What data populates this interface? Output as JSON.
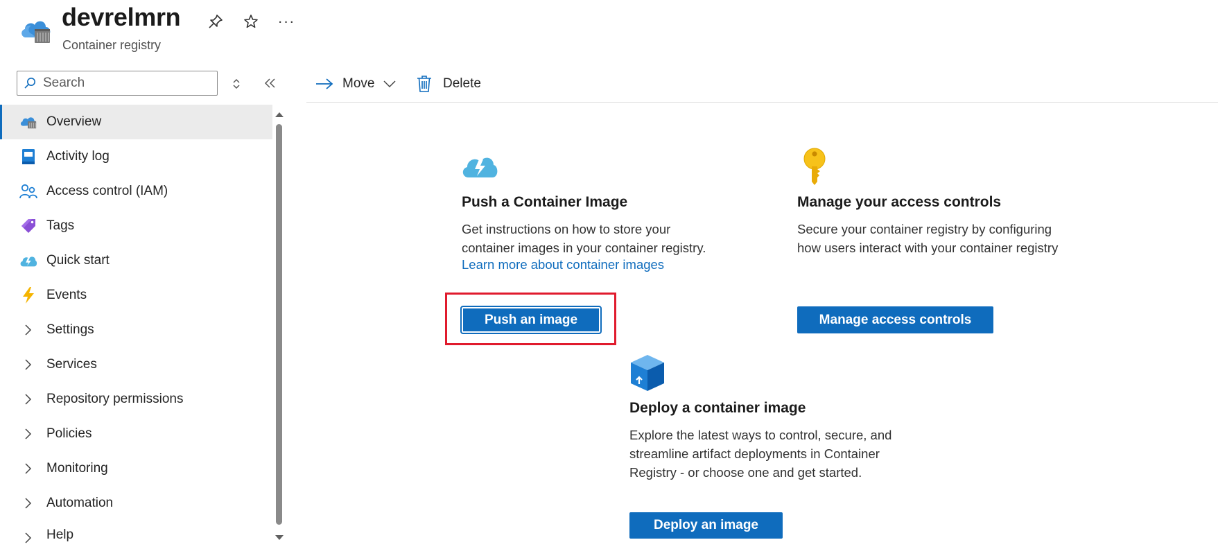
{
  "header": {
    "title": "devrelmrn",
    "subtitle": "Container registry",
    "more_label": "···"
  },
  "sidebar": {
    "search": {
      "placeholder": "Search",
      "value": ""
    },
    "items": [
      {
        "label": "Overview",
        "icon": "container-registry-icon",
        "selected": true
      },
      {
        "label": "Activity log",
        "icon": "activity-log-icon"
      },
      {
        "label": "Access control (IAM)",
        "icon": "people-icon"
      },
      {
        "label": "Tags",
        "icon": "tag-icon"
      },
      {
        "label": "Quick start",
        "icon": "cloud-lightning-icon"
      },
      {
        "label": "Events",
        "icon": "lightning-icon"
      },
      {
        "label": "Settings",
        "icon": "chevron-right-icon"
      },
      {
        "label": "Services",
        "icon": "chevron-right-icon"
      },
      {
        "label": "Repository permissions",
        "icon": "chevron-right-icon"
      },
      {
        "label": "Policies",
        "icon": "chevron-right-icon"
      },
      {
        "label": "Monitoring",
        "icon": "chevron-right-icon"
      },
      {
        "label": "Automation",
        "icon": "chevron-right-icon"
      },
      {
        "label": "Help",
        "icon": "chevron-right-icon"
      }
    ]
  },
  "toolbar": {
    "move_label": "Move",
    "delete_label": "Delete"
  },
  "cards": {
    "push": {
      "title": "Push a Container Image",
      "desc_line1": "Get instructions on how to store your",
      "desc_line2": "container images in your container registry.",
      "link": "Learn more about container images",
      "button": "Push an image"
    },
    "manage": {
      "title": "Manage your access controls",
      "desc_line1": "Secure your container registry by configuring",
      "desc_line2": "how users interact with your container registry",
      "button": "Manage access controls"
    },
    "deploy": {
      "title": "Deploy a container image",
      "desc_line1": "Explore the latest ways to control, secure, and",
      "desc_line2": "streamline artifact deployments in Container",
      "desc_line3": "Registry - or choose one and get started.",
      "button": "Deploy an image"
    }
  },
  "colors": {
    "accent": "#0f6cbd",
    "highlight": "#e01b2d",
    "selected_bg": "#ebebeb"
  }
}
